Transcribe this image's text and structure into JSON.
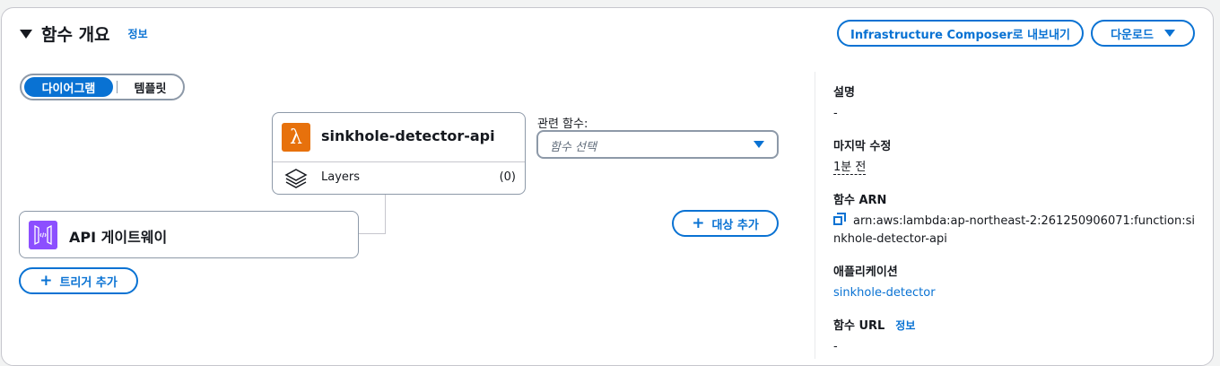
{
  "header": {
    "title": "함수 개요",
    "info": "정보"
  },
  "buttons": {
    "composer": "Infrastructure Composer로 내보내기",
    "download": "다운로드",
    "add_trigger": "트리거 추가",
    "add_target": "대상 추가"
  },
  "view_toggle": {
    "diagram": "다이어그램",
    "template": "템플릿"
  },
  "function_card": {
    "name": "sinkhole-detector-api",
    "layers_label": "Layers",
    "layers_count": "(0)"
  },
  "trigger_card": {
    "name": "API 게이트웨이"
  },
  "related": {
    "label": "관련 함수:",
    "placeholder": "함수 선택"
  },
  "details": {
    "description_label": "설명",
    "description_value": "-",
    "modified_label": "마지막 수정",
    "modified_value": "1분 전",
    "arn_label": "함수 ARN",
    "arn_value_line1": "arn:aws:lambda:ap-northeast-2:261250906071:function:si",
    "arn_value_line2": "nkhole-detector-api",
    "app_label": "애플리케이션",
    "app_value": "sinkhole-detector",
    "url_label": "함수 URL",
    "url_info": "정보",
    "url_value": "-"
  },
  "colors": {
    "accent": "#0972d3",
    "lambda": "#e7710c",
    "apigw": "#8c4fff"
  }
}
